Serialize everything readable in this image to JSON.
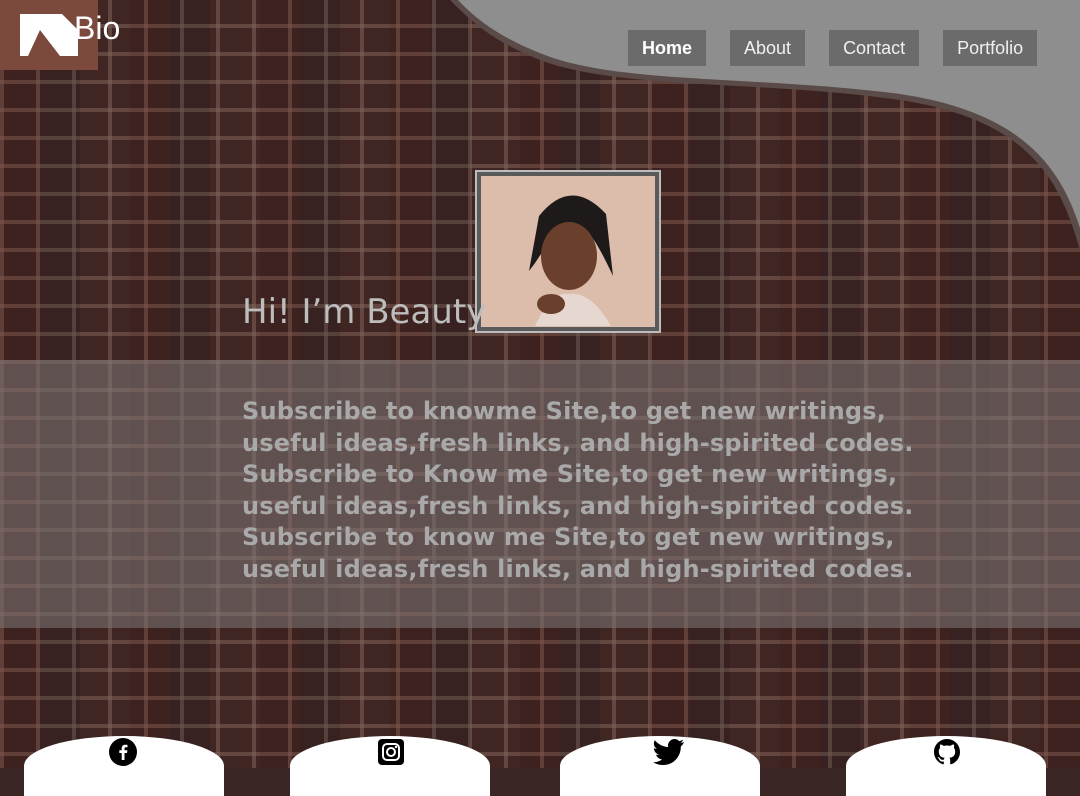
{
  "brand": {
    "name": "Bio"
  },
  "nav": {
    "items": [
      {
        "label": "Home",
        "active": true
      },
      {
        "label": "About"
      },
      {
        "label": "Contact"
      },
      {
        "label": "Portfolio"
      }
    ]
  },
  "hero": {
    "greeting": "Hi! I’m Beauty"
  },
  "band": {
    "lines": [
      "Subscribe to knowme Site,to get new writings,",
      "useful ideas,fresh links, and high-spirited codes.",
      "Subscribe to Know me Site,to get new writings,",
      "useful ideas,fresh links, and high-spirited codes.",
      "Subscribe to know me Site,to get new writings,",
      "useful ideas,fresh links, and high-spirited codes."
    ]
  },
  "social": [
    "facebook-icon",
    "instagram-icon",
    "twitter-icon",
    "github-icon"
  ],
  "colors": {
    "logo_bg": "#7b4a3d",
    "nav_bg": "#6b6b6b",
    "wave": "#8e8e8e",
    "wave_edge": "#5a4a48"
  }
}
